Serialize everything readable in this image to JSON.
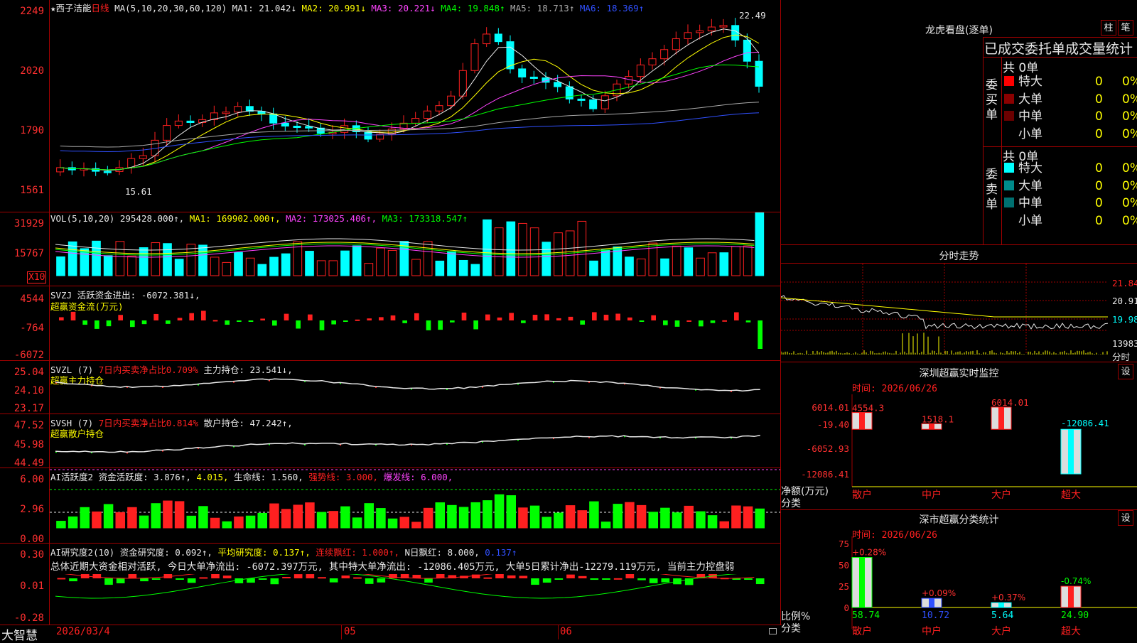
{
  "stock": {
    "star": "★",
    "name": "西子洁能",
    "period": "日线",
    "ma_label": "MA(5,10,20,30,60,120)",
    "ma": [
      {
        "name": "MA1:",
        "value": "21.042",
        "dir": "↓",
        "color": "#e8e8e8"
      },
      {
        "name": "MA2:",
        "value": "20.991",
        "dir": "↓",
        "color": "#ffff00"
      },
      {
        "name": "MA3:",
        "value": "20.221",
        "dir": "↓",
        "color": "#ff44ff"
      },
      {
        "name": "MA4:",
        "value": "19.848",
        "dir": "↑",
        "color": "#00ff00"
      },
      {
        "name": "MA5:",
        "value": "18.713",
        "dir": "↑",
        "color": "#aaaaaa"
      },
      {
        "name": "MA6:",
        "value": "18.369",
        "dir": "↑",
        "color": "#3050ff"
      }
    ],
    "price_axis": [
      "2249",
      "2020",
      "1790",
      "1561"
    ],
    "high_mark": "22.49",
    "low_mark": "15.61"
  },
  "vol": {
    "label": "VOL(5,10,20)",
    "value": "295428.000↑,",
    "ma1": "MA1: 169902.000↑,",
    "ma2": "MA2: 173025.406↑,",
    "ma3": "MA3: 173318.547↑",
    "axis": [
      "31929",
      "15767"
    ],
    "unit": "X10"
  },
  "svzj": {
    "label": "SVZJ",
    "title": "活跃资金进出: -6072.381↓,",
    "sub": "超赢资金流(万元)",
    "axis": [
      "4544",
      "-764",
      "-6072"
    ]
  },
  "svzl": {
    "label": "SVZL (7)",
    "a": "7日内买卖净占比0.709%",
    "b": "主力持仓: 23.541↓,",
    "sub": "超赢主力持仓",
    "axis": [
      "25.04",
      "24.10",
      "23.17"
    ]
  },
  "svsh": {
    "label": "SVSH (7)",
    "a": "7日内买卖净占比0.814%",
    "b": "散户持仓: 47.242↑,",
    "sub": "超赢散户持仓",
    "axis": [
      "47.52",
      "45.98",
      "44.49"
    ]
  },
  "ai_act": {
    "label": "AI活跃度2",
    "a": "资金活跃度: 3.876↑,",
    "b": "4.015,",
    "c": "生命线: 1.560,",
    "d": "强势线: 3.000,",
    "e": "爆发线: 6.000,",
    "axis": [
      "6.00",
      "2.96",
      "0.00"
    ]
  },
  "ai_res": {
    "label": "AI研究度2(10)",
    "a": "资金研究度: 0.092↑,",
    "b": "平均研究度: 0.137↑,",
    "c": "连续飘红: 1.000↑,",
    "d": "N日飘红: 8.000,",
    "e": "0.137↑",
    "summary": "总体近期大资金相对活跃, 今日大单净流出: -6072.397万元, 其中特大单净流出: -12086.405万元, 大单5日累计净出-12279.119万元, 当前主力控盘弱",
    "axis": [
      "0.30",
      "0.01",
      "-0.28"
    ]
  },
  "bottom": {
    "brand": "大智慧",
    "date": "2026/03/4",
    "m1": "05",
    "m2": "06"
  },
  "right": {
    "lhb_title": "龙虎看盘(逐单)",
    "btn_zhu": "柱",
    "btn_bi": "笔",
    "tabs": "已成交委托单成交量统计",
    "buy_total": "共 0单",
    "buy_side": "委买单",
    "sell_total": "共 0单",
    "sell_side": "委卖单",
    "rows": [
      {
        "label": "特大",
        "count": "0",
        "pct": "0%"
      },
      {
        "label": "大单",
        "count": "0",
        "pct": "0%"
      },
      {
        "label": "中单",
        "count": "0",
        "pct": "0%"
      },
      {
        "label": "小单",
        "count": "0",
        "pct": "0%"
      }
    ],
    "fenshi_title": "分时走势",
    "fenshi_axis": [
      "21.84",
      "20.91",
      "19.98",
      "13983",
      "分时"
    ],
    "monitor_title": "深圳超赢实时监控",
    "settings": "设",
    "monitor_time": "时间: 2026/06/26",
    "monitor_axis": [
      "6014.01",
      "-19.40",
      "-6052.93",
      "-12086.41"
    ],
    "monitor_ylabel": "净额(万元)",
    "monitor_xlabel": "分类",
    "monitor_bars": [
      {
        "cat": "散户",
        "value": "4554.3"
      },
      {
        "cat": "中户",
        "value": "1518.1"
      },
      {
        "cat": "大户",
        "value": "6014.01"
      },
      {
        "cat": "超大",
        "value": "-12086.41"
      }
    ],
    "stat_title": "深市超赢分类统计",
    "stat_time": "时间: 2026/06/26",
    "stat_axis": [
      "75",
      "50",
      "25",
      "0"
    ],
    "stat_ylabel": "比例%",
    "stat_xlabel": "分类",
    "stat_bars": [
      {
        "cat": "散户",
        "pct": "58.74",
        "chg": "+0.28%"
      },
      {
        "cat": "中户",
        "pct": "10.72",
        "chg": "+0.09%"
      },
      {
        "cat": "大户",
        "pct": "5.64",
        "chg": "+0.37%"
      },
      {
        "cat": "超大",
        "pct": "24.90",
        "chg": "-0.74%"
      }
    ]
  }
}
